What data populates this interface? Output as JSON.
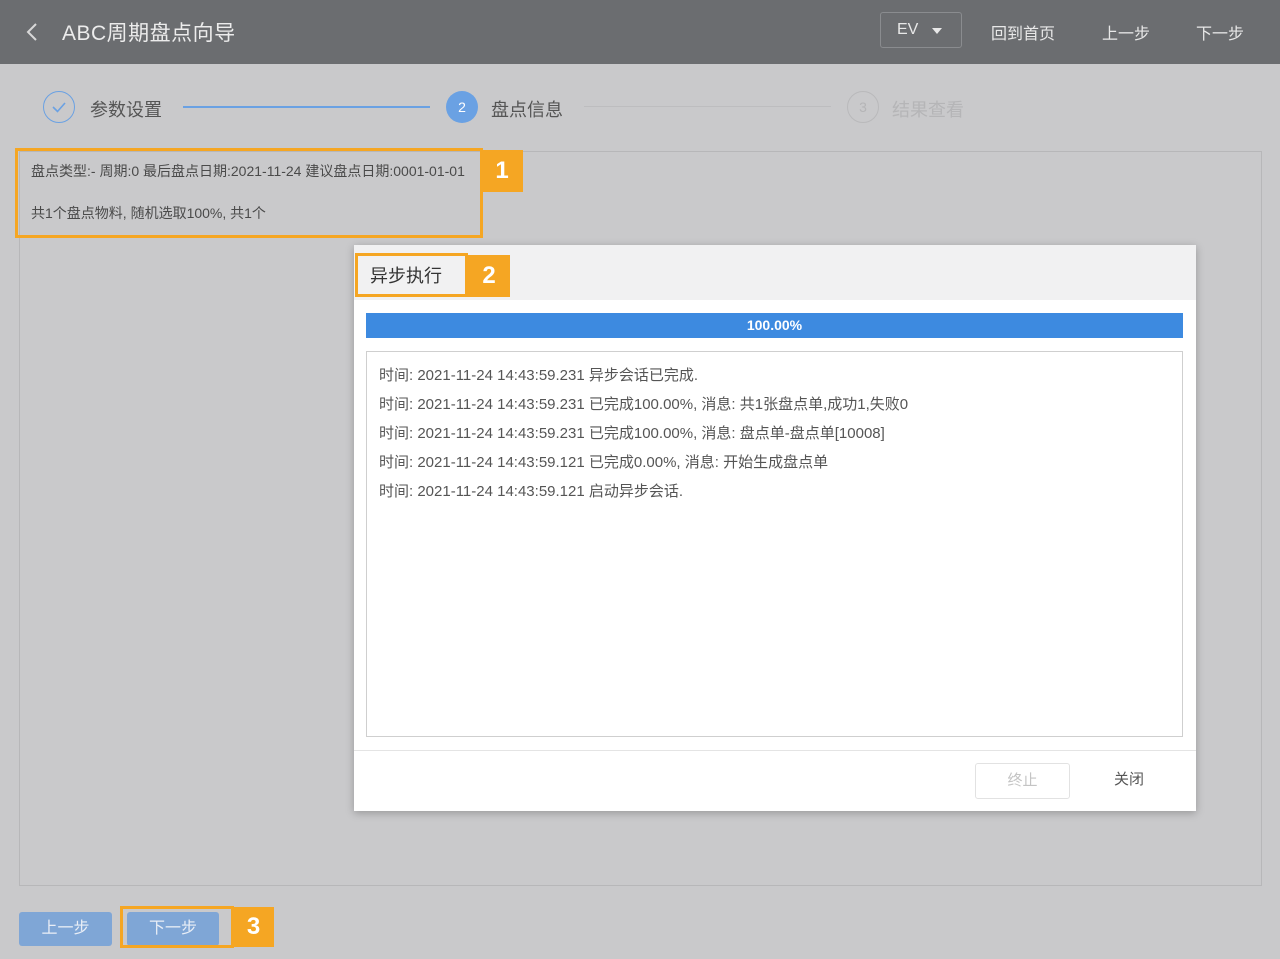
{
  "header": {
    "title": "ABC周期盘点向导",
    "env_select": "EV",
    "home_link": "回到首页",
    "prev_link": "上一步",
    "next_link": "下一步"
  },
  "steps": [
    {
      "number": "1",
      "label": "参数设置",
      "state": "done"
    },
    {
      "number": "2",
      "label": "盘点信息",
      "state": "active"
    },
    {
      "number": "3",
      "label": "结果查看",
      "state": "pending"
    }
  ],
  "info": {
    "line1": "盘点类型:- 周期:0 最后盘点日期:2021-11-24 建议盘点日期:0001-01-01",
    "line2": "共1个盘点物料, 随机选取100%, 共1个"
  },
  "dialog": {
    "title": "异步执行",
    "progress_text": "100.00%",
    "progress_value": 100,
    "logs": [
      "时间: 2021-11-24 14:43:59.231 异步会话已完成.",
      "时间: 2021-11-24 14:43:59.231 已完成100.00%, 消息: 共1张盘点单,成功1,失败0",
      "时间: 2021-11-24 14:43:59.231 已完成100.00%, 消息: 盘点单-盘点单[10008]",
      "时间: 2021-11-24 14:43:59.121 已完成0.00%, 消息: 开始生成盘点单",
      "时间: 2021-11-24 14:43:59.121 启动异步会话."
    ],
    "stop_label": "终止",
    "close_label": "关闭"
  },
  "footer": {
    "prev_label": "上一步",
    "next_label": "下一步"
  },
  "callouts": [
    "1",
    "2",
    "3"
  ],
  "colors": {
    "header_bg": "#6b6d70",
    "accent": "#3d8ae0",
    "callout": "#f5a623",
    "button_bg": "#7fa6d6"
  }
}
